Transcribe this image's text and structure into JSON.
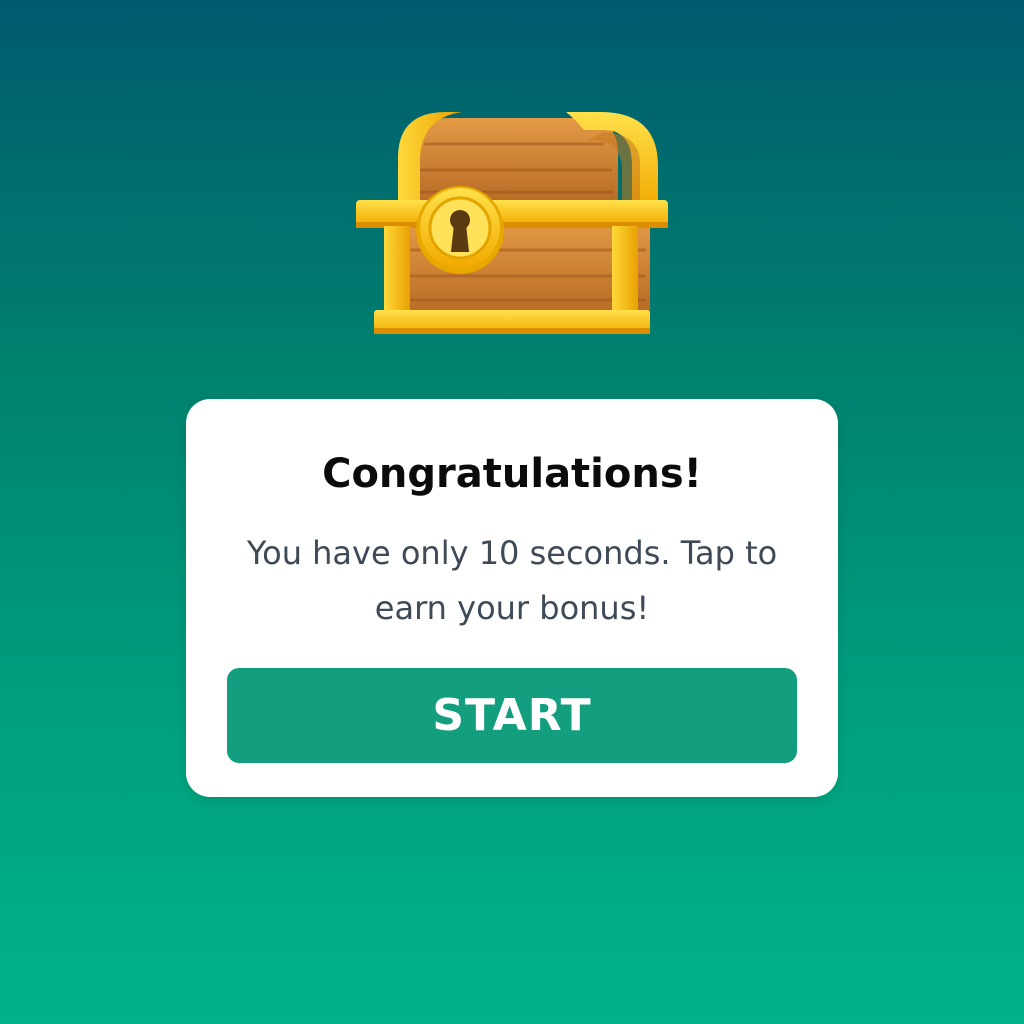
{
  "dialog": {
    "title": "Congratulations!",
    "message": "You have only 10 seconds. Tap to earn your bonus!",
    "start_label": "START"
  },
  "icons": {
    "reward": "treasure-chest-icon",
    "lock": "keyhole-icon"
  },
  "colors": {
    "background_top": "#005a6e",
    "background_bottom": "#00b388",
    "button": "#129e7f",
    "title_text": "#0b0b0b",
    "message_text": "#3e4a57"
  }
}
